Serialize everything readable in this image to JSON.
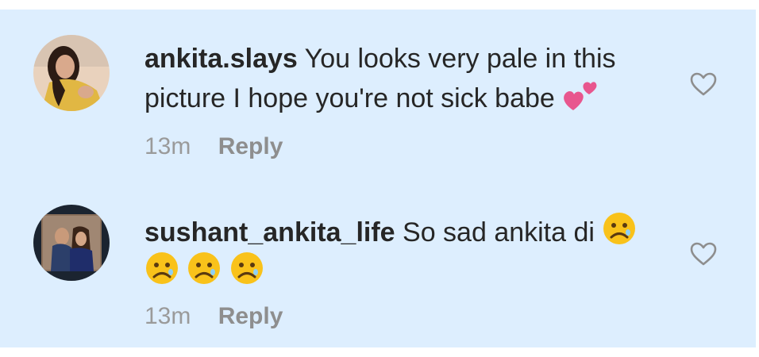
{
  "comments": [
    {
      "username": "ankita.slays",
      "text_line1": "You looks very pale in this",
      "text_line2": "picture I hope you're not sick babe",
      "emoji": "two-hearts",
      "time": "13m",
      "reply_label": "Reply"
    },
    {
      "username": "sushant_ankita_life",
      "text_line1": "So sad ankita di",
      "emoji": "sad-face",
      "emoji_count_line2": 3,
      "time": "13m",
      "reply_label": "Reply"
    }
  ],
  "colors": {
    "panel_bg": "#ddeefe",
    "text": "#262626",
    "meta": "#9a9a9a",
    "heart_outline": "#8e8e8e",
    "emoji_yellow": "#f9c21a",
    "emoji_pink": "#e8568e"
  },
  "icons": [
    "heart-outline-icon",
    "two-hearts-emoji",
    "sad-face-emoji"
  ]
}
